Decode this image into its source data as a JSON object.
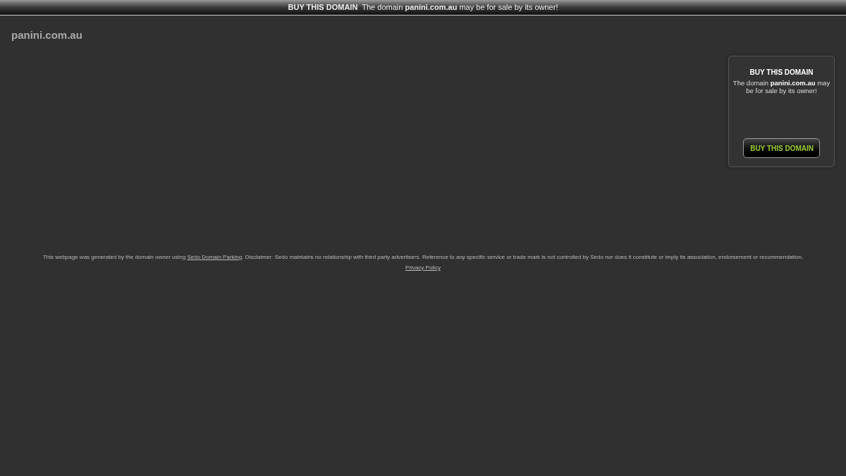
{
  "top_bar": {
    "label": "BUY THIS DOMAIN",
    "text_before": "The domain",
    "domain": "panini.com.au",
    "text_after": "may be for sale by its owner!"
  },
  "site_title": "panini.com.au",
  "sale_card": {
    "heading": "BUY THIS DOMAIN",
    "text_before": "The domain",
    "domain": "panini.com.au",
    "text_after": "may be for sale by its owner!",
    "button": "BUY THIS DOMAIN"
  },
  "footer": {
    "text_before": "This webpage was generated by the domain owner using",
    "link": "Sedo Domain Parking",
    "text_after": ". Disclaimer: Sedo maintains no relationship with third party advertisers. Reference to any specific service or trade mark is not controlled by Sedo nor does it constitute or imply its association, endorsement or recommendation.",
    "privacy_link": "Privacy Policy"
  }
}
